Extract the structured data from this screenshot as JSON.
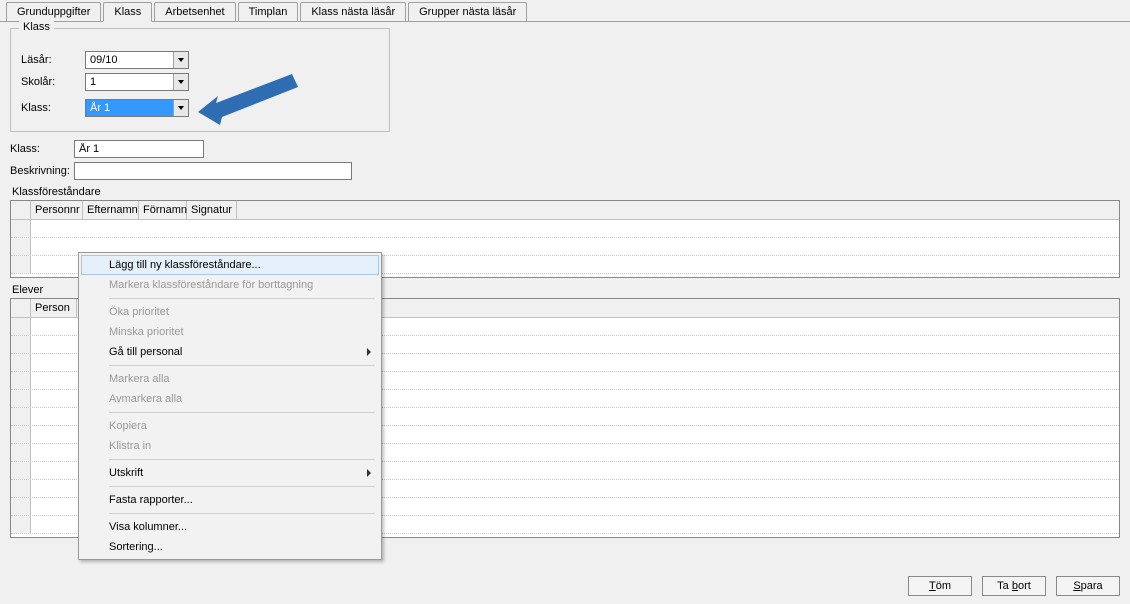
{
  "tabs": [
    "Grunduppgifter",
    "Klass",
    "Arbetsenhet",
    "Timplan",
    "Klass nästa läsår",
    "Grupper nästa läsår"
  ],
  "active_tab": 1,
  "groupbox": {
    "title": "Klass",
    "lasar_label": "Läsår:",
    "lasar_value": "09/10",
    "skolar_label": "Skolår:",
    "skolar_value": "1",
    "klass_label": "Klass:",
    "klass_value": "År 1"
  },
  "klass_field_label": "Klass:",
  "klass_field_value": "År 1",
  "beskrivning_label": "Beskrivning:",
  "beskrivning_value": "",
  "klassforestandare_label": "Klassföreståndare",
  "klassforestandare_cols": [
    "Personnr",
    "Efternamn",
    "Förnamn",
    "Signatur"
  ],
  "elever_label": "Elever",
  "elever_cols": [
    "Person"
  ],
  "context_menu": [
    {
      "label": "Lägg till ny klassföreståndare...",
      "enabled": true,
      "highlight": true
    },
    {
      "label": "Markera klassföreståndare för borttagning",
      "enabled": false
    },
    {
      "sep": true
    },
    {
      "label": "Öka prioritet",
      "enabled": false
    },
    {
      "label": "Minska prioritet",
      "enabled": false
    },
    {
      "label": "Gå till personal",
      "enabled": true,
      "submenu": true
    },
    {
      "sep": true
    },
    {
      "label": "Markera alla",
      "enabled": false
    },
    {
      "label": "Avmarkera alla",
      "enabled": false
    },
    {
      "sep": true
    },
    {
      "label": "Kopiera",
      "enabled": false
    },
    {
      "label": "Klistra in",
      "enabled": false
    },
    {
      "sep": true
    },
    {
      "label": "Utskrift",
      "enabled": true,
      "submenu": true
    },
    {
      "sep": true
    },
    {
      "label": "Fasta rapporter...",
      "enabled": true
    },
    {
      "sep": true
    },
    {
      "label": "Visa kolumner...",
      "enabled": true
    },
    {
      "label": "Sortering...",
      "enabled": true
    }
  ],
  "buttons": {
    "tom": "Töm",
    "tabort": "Ta bort",
    "spara": "Spara"
  }
}
